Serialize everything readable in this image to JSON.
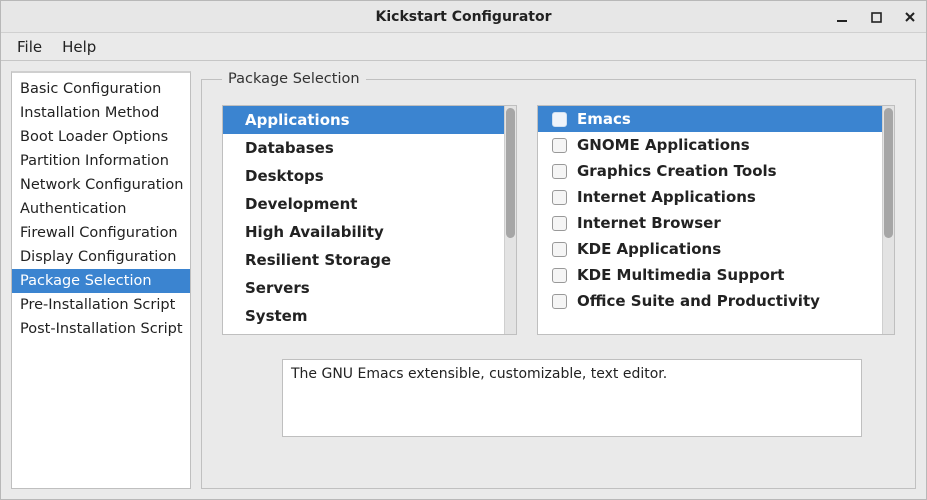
{
  "window": {
    "title": "Kickstart Configurator"
  },
  "menubar": {
    "file": "File",
    "help": "Help"
  },
  "sidebar": {
    "items": [
      {
        "label": "Basic Configuration"
      },
      {
        "label": "Installation Method"
      },
      {
        "label": "Boot Loader Options"
      },
      {
        "label": "Partition Information"
      },
      {
        "label": "Network Configuration"
      },
      {
        "label": "Authentication"
      },
      {
        "label": "Firewall Configuration"
      },
      {
        "label": "Display Configuration"
      },
      {
        "label": "Package Selection"
      },
      {
        "label": "Pre-Installation Script"
      },
      {
        "label": "Post-Installation Script"
      }
    ],
    "selected_index": 8
  },
  "group": {
    "legend": "Package Selection"
  },
  "categories": {
    "items": [
      "Applications",
      "Databases",
      "Desktops",
      "Development",
      "High Availability",
      "Resilient Storage",
      "Servers",
      "System"
    ],
    "selected_index": 0
  },
  "packages": {
    "items": [
      "Emacs",
      "GNOME Applications",
      "Graphics Creation Tools",
      "Internet Applications",
      "Internet Browser",
      "KDE Applications",
      "KDE Multimedia Support",
      "Office Suite and Productivity"
    ],
    "selected_index": 0
  },
  "description": "The GNU Emacs extensible, customizable, text editor."
}
